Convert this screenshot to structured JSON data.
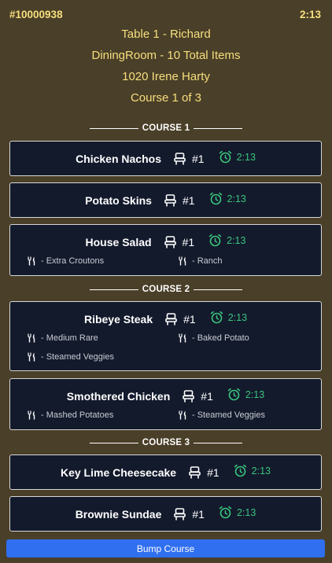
{
  "order": {
    "number": "#10000938",
    "timer": "2:13",
    "table_line": "Table 1 - Richard",
    "location_line": "DiningRoom - 10 Total Items",
    "address_line": "1020 Irene Harty",
    "course_line": "Course 1 of 3"
  },
  "courses": [
    {
      "label": "COURSE 1",
      "items": [
        {
          "name": "Chicken Nachos",
          "seat": "#1",
          "timer": "2:13",
          "modifiers": []
        },
        {
          "name": "Potato Skins",
          "seat": "#1",
          "timer": "2:13",
          "modifiers": []
        },
        {
          "name": "House Salad",
          "seat": "#1",
          "timer": "2:13",
          "modifiers": [
            "- Extra Croutons",
            "- Ranch"
          ]
        }
      ]
    },
    {
      "label": "COURSE 2",
      "items": [
        {
          "name": "Ribeye Steak",
          "seat": "#1",
          "timer": "2:13",
          "modifiers": [
            "- Medium Rare",
            "- Baked Potato",
            "- Steamed Veggies"
          ]
        },
        {
          "name": "Smothered Chicken",
          "seat": "#1",
          "timer": "2:13",
          "modifiers": [
            "- Mashed Potatoes",
            "- Steamed Veggies"
          ]
        }
      ]
    },
    {
      "label": "COURSE 3",
      "items": [
        {
          "name": "Key Lime Cheesecake",
          "seat": "#1",
          "timer": "2:13",
          "modifiers": []
        },
        {
          "name": "Brownie Sundae",
          "seat": "#1",
          "timer": "2:13",
          "modifiers": []
        }
      ]
    }
  ],
  "actions": {
    "bump_label": "Bump Course"
  },
  "icons": {
    "seat": "chair-icon",
    "timer": "alarm-clock-icon",
    "modifier": "fork-knife-icon"
  },
  "colors": {
    "background": "#4a3f28",
    "header_text": "#f6df7e",
    "card_background": "#131a2c",
    "timer_green": "#3ac47d",
    "button_blue": "#2f6ff0"
  }
}
